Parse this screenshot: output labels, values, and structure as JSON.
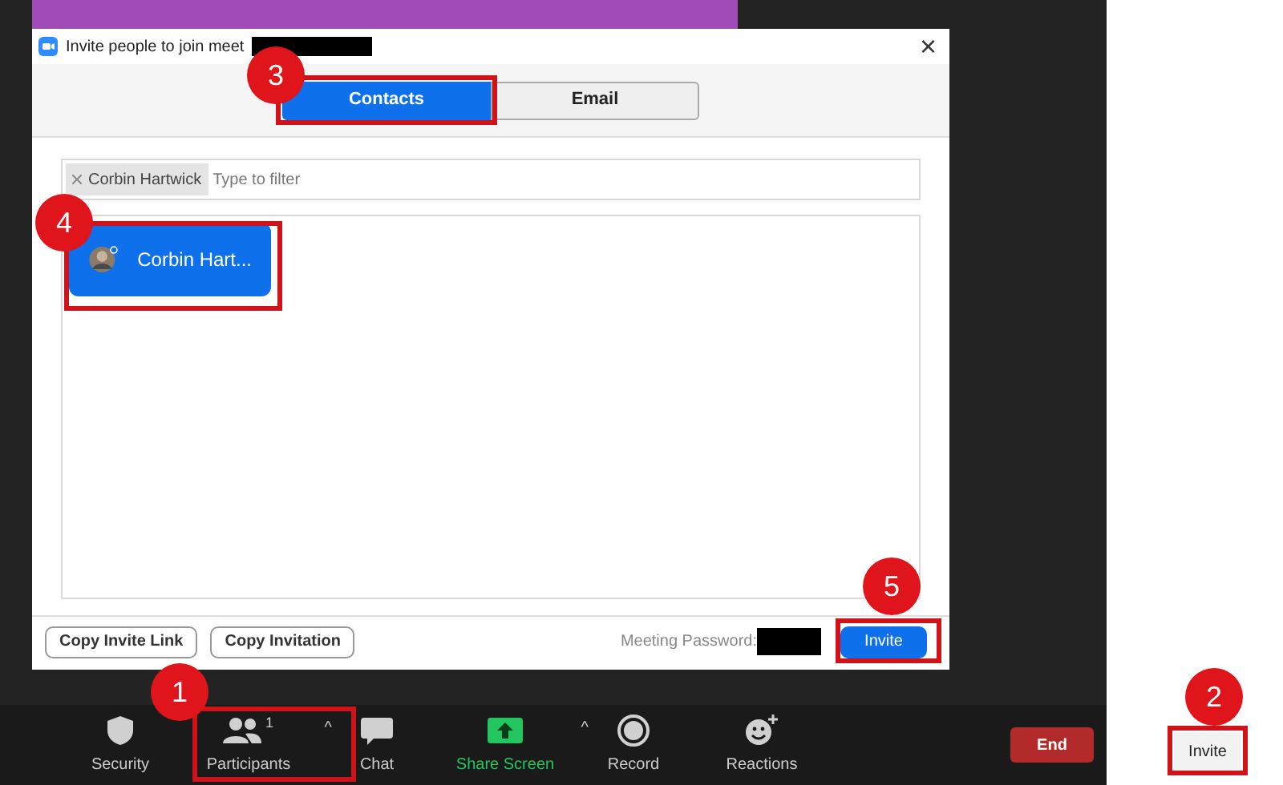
{
  "dialog": {
    "title": "Invite people to join meet",
    "close": "×",
    "tabs": [
      {
        "label": "Contacts",
        "selected": true
      },
      {
        "label": "Email",
        "selected": false
      }
    ],
    "filter": {
      "chips": [
        "Corbin Hartwick"
      ],
      "placeholder": "Type to filter"
    },
    "contacts": [
      {
        "name": "Corbin Hart...",
        "selected": true
      }
    ],
    "footer": {
      "buttons": [
        "Copy Invite Link",
        "Copy Invitation"
      ],
      "password_label": "Meeting Password:",
      "invite": "Invite"
    }
  },
  "toolbar": [
    {
      "kind": "security",
      "label": "Security"
    },
    {
      "kind": "participants",
      "label": "Participants",
      "count": "1",
      "caret": "^"
    },
    {
      "kind": "chat",
      "label": "Chat"
    },
    {
      "kind": "share",
      "label": "Share Screen",
      "caret": "^"
    },
    {
      "kind": "record",
      "label": "Record"
    },
    {
      "kind": "reactions",
      "label": "Reactions"
    }
  ],
  "end_button": "End",
  "side_panel": {
    "invite_button": "Invite"
  },
  "annotations": [
    "1",
    "2",
    "3",
    "4",
    "5"
  ]
}
